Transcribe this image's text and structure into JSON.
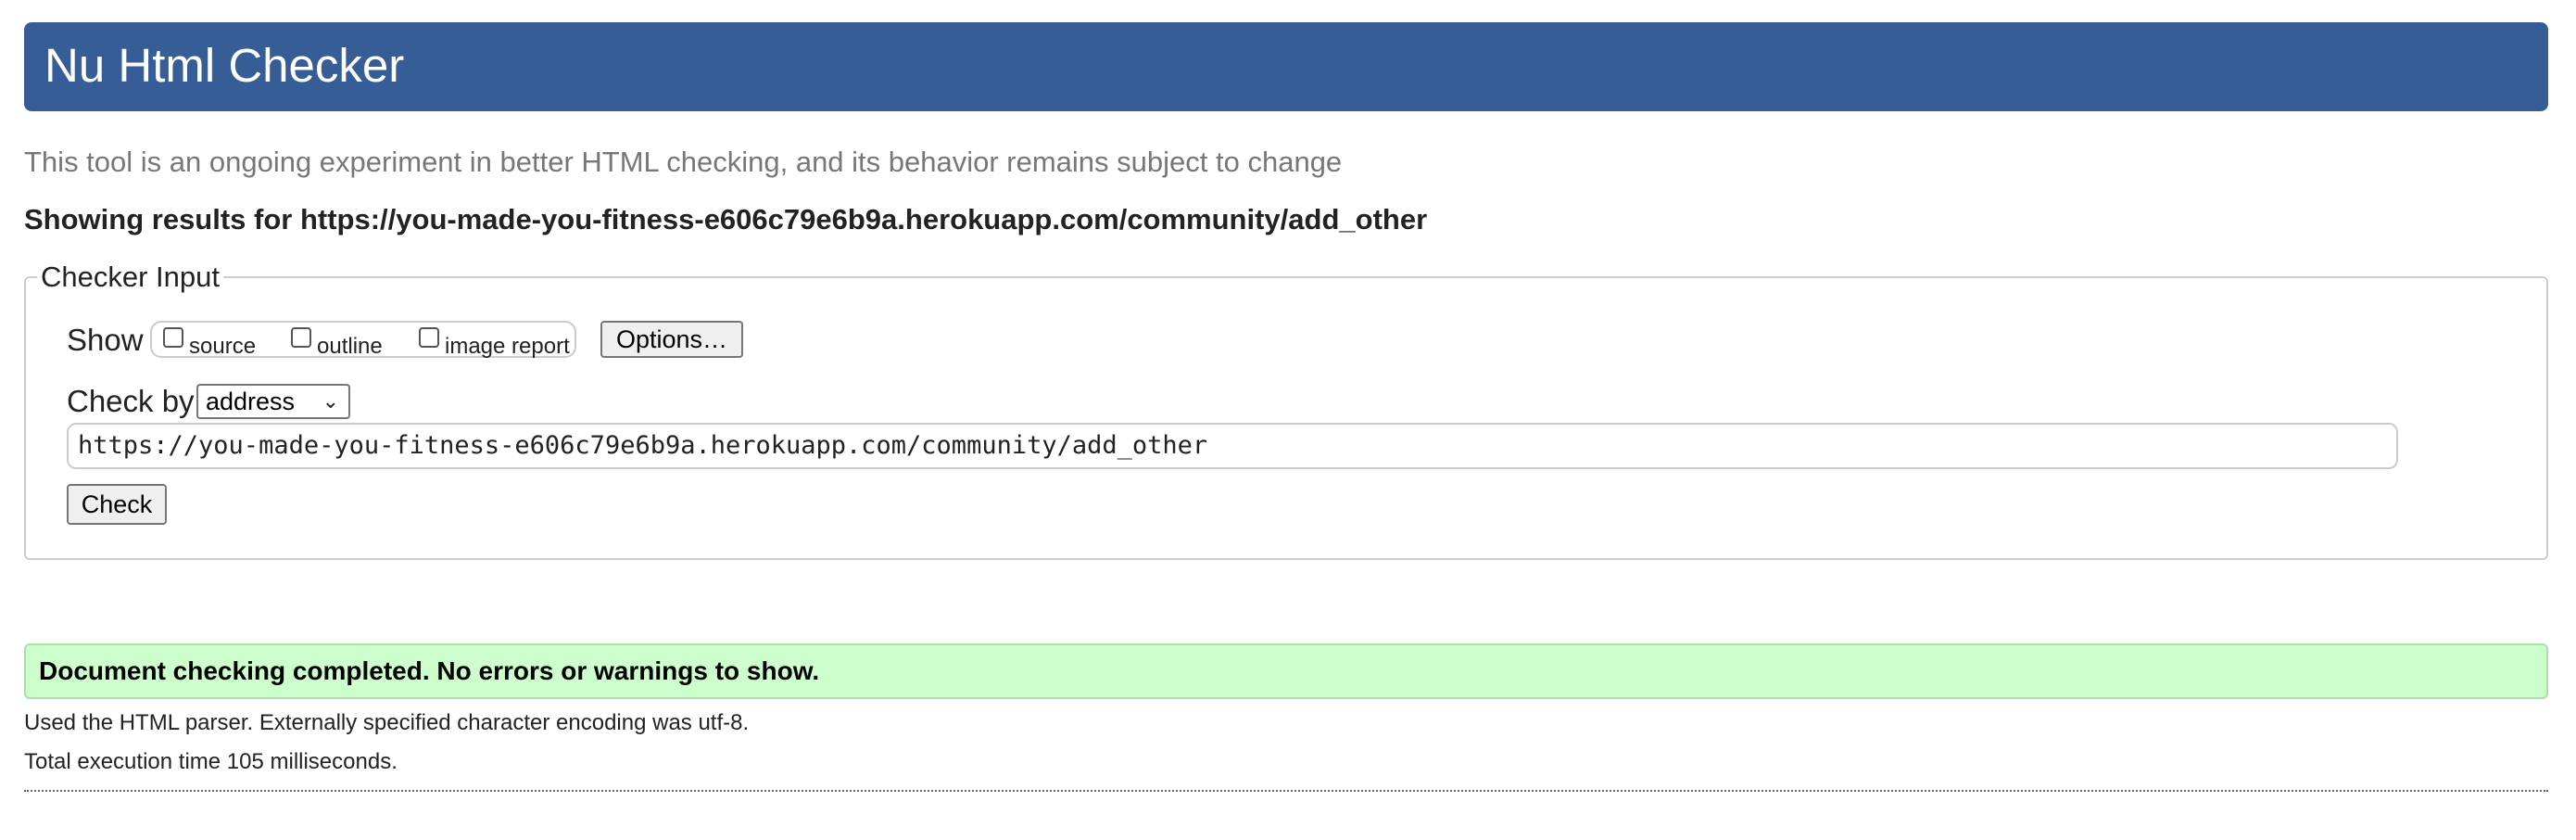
{
  "header": {
    "title": "Nu Html Checker"
  },
  "intro": {
    "subtitle": "This tool is an ongoing experiment in better HTML checking, and its behavior remains subject to change"
  },
  "results_heading": "Showing results for https://you-made-you-fitness-e606c79e6b9a.herokuapp.com/community/add_other",
  "checker_input": {
    "legend": "Checker Input",
    "show_label": "Show",
    "show_options": [
      {
        "label": "source",
        "checked": false
      },
      {
        "label": "outline",
        "checked": false
      },
      {
        "label": "image report",
        "checked": false
      }
    ],
    "options_button": "Options…",
    "check_by_label": "Check by",
    "check_by_selected": "address",
    "url_value": "https://you-made-you-fitness-e606c79e6b9a.herokuapp.com/community/add_other",
    "check_button": "Check"
  },
  "result": {
    "success_message": "Document checking completed. No errors or warnings to show.",
    "parser_info": "Used the HTML parser. Externally specified character encoding was utf-8.",
    "execution_time": "Total execution time 105 milliseconds."
  },
  "colors": {
    "header_bg": "#365d95",
    "success_bg": "#ccffcc",
    "subtitle_text": "#777777"
  }
}
